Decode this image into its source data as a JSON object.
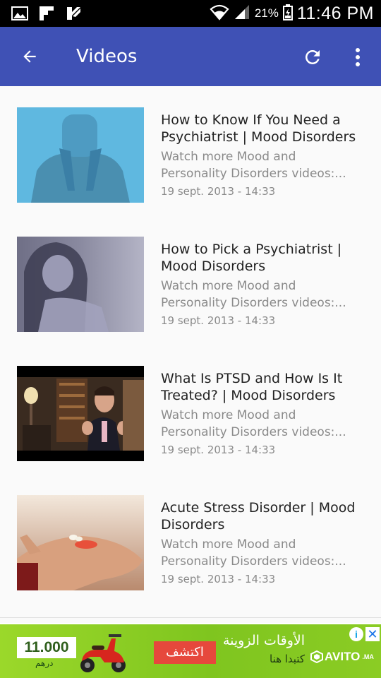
{
  "status_bar": {
    "notification_icons": [
      "gallery-icon",
      "flipboard-icon",
      "check-app-icon"
    ],
    "wifi_icon": "wifi-icon",
    "signal_icon": "signal-icon",
    "battery_percent": "21%",
    "battery_icon": "battery-charging-icon",
    "time": "11:46 PM"
  },
  "app_bar": {
    "title": "Videos",
    "back_icon": "arrow-back-icon",
    "refresh_icon": "refresh-icon",
    "more_icon": "more-vert-icon",
    "color": "#3f51b5"
  },
  "videos": [
    {
      "title": "How to Know If You Need a Psychiatrist | Mood Disorders",
      "desc_line1": "Watch more Mood and",
      "desc_line2": "Personality Disorders videos:...",
      "date": "19 sept. 2013 - 14:33"
    },
    {
      "title": "How to Pick a Psychiatrist | Mood Disorders",
      "desc_line1": "Watch more Mood and",
      "desc_line2": "Personality Disorders videos:...",
      "date": "19 sept. 2013 - 14:33"
    },
    {
      "title": "What Is PTSD and How Is It Treated? | Mood Disorders",
      "desc_line1": "Watch more Mood and",
      "desc_line2": "Personality Disorders videos:...",
      "date": "19 sept. 2013 - 14:33"
    },
    {
      "title": "Acute Stress Disorder | Mood Disorders",
      "desc_line1": "Watch more Mood and",
      "desc_line2": "Personality Disorders videos:...",
      "date": "19 sept. 2013 - 14:33"
    }
  ],
  "ad": {
    "price": "11.000",
    "currency": "درهم",
    "cta": "اكتشف",
    "headline": "الأوقات الزوينة",
    "subline": "كتبدا هنا",
    "brand": "AVITO",
    "brand_suffix": ".MA",
    "info_icon": "info-icon",
    "close_icon": "close-icon"
  }
}
